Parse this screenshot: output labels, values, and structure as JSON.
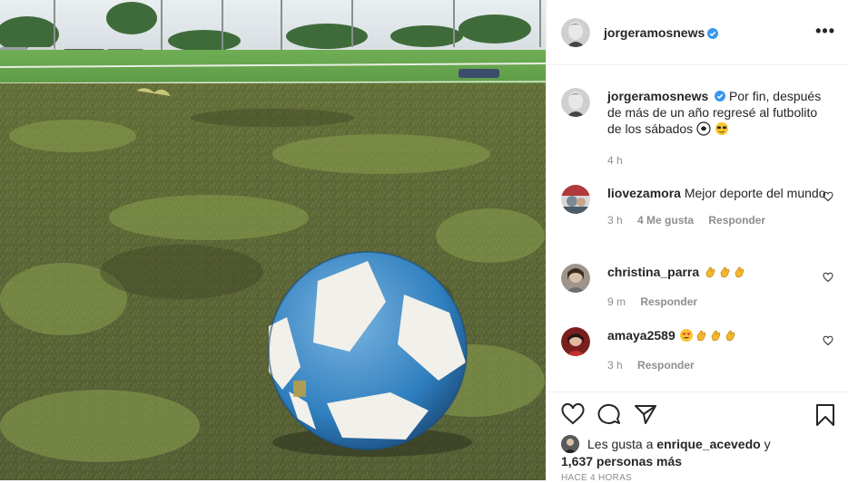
{
  "post": {
    "author": "jorgeramosnews",
    "caption": "Por fin, después de más de un año regresé al futbolito de los sábados",
    "caption_emojis": [
      "soccer-ball",
      "sunglasses-face"
    ],
    "time": "4 h"
  },
  "comments": [
    {
      "user": "liovezamora",
      "text": "Mejor deporte del mundo",
      "time": "3 h",
      "likes": "4 Me gusta",
      "reply": "Responder"
    },
    {
      "user": "christina_parra",
      "text": "",
      "emojis": [
        "clap",
        "clap",
        "clap"
      ],
      "time": "9 m",
      "reply": "Responder"
    },
    {
      "user": "amaya2589",
      "text": "",
      "emojis": [
        "heart-eyes",
        "clap",
        "clap",
        "clap"
      ],
      "time": "3 h",
      "reply": "Responder"
    }
  ],
  "likes": {
    "prefix": "Les gusta a",
    "user": "enrique_acevedo",
    "joiner": "y",
    "others": "1,637 personas más"
  },
  "timestamp": "HACE 4 HORAS",
  "colors": {
    "verified": "#3897f0",
    "text": "#262626",
    "muted": "#8e8e8e",
    "border": "#efefef"
  }
}
